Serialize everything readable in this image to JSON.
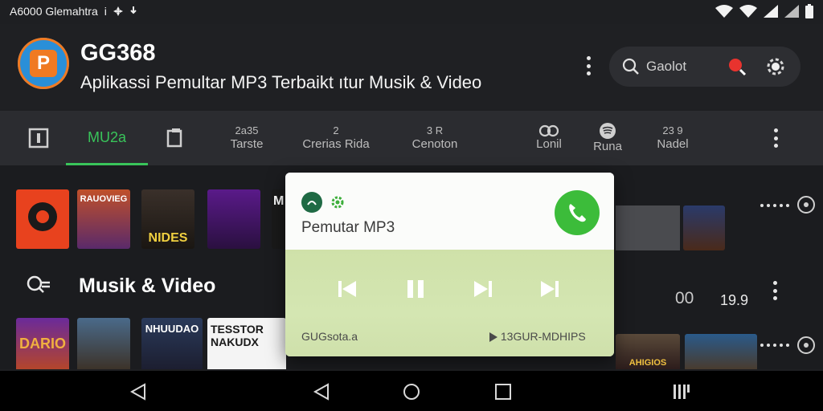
{
  "status_bar": {
    "left_text": "A6000 Glemahtra",
    "left_mark": "i"
  },
  "header": {
    "app_name": "GG368",
    "subtitle": "Aplikassi Pemultar MP3 Terbaikt ıtur Musik & Video",
    "search_placeholder": "Gaolot"
  },
  "tabs": [
    {
      "top": "",
      "label": "",
      "icon": "square-frame-icon"
    },
    {
      "top": "",
      "label": "MU2a",
      "active": true
    },
    {
      "top": "",
      "label": "",
      "icon": "copy-icon"
    },
    {
      "top": "2a35",
      "label": "Tarste"
    },
    {
      "top": "2",
      "label": "Crerias Rida"
    },
    {
      "top": "3 R",
      "label": "Cenoton"
    },
    {
      "top": "",
      "label": "Lonil",
      "icon": "link-icon"
    },
    {
      "top": "",
      "label": "Runa",
      "icon": "spotify-icon"
    },
    {
      "top": "23 9",
      "label": "Nadel"
    }
  ],
  "content": {
    "section_title": "Musik & Video",
    "number_a": "00",
    "number_b": "19.9",
    "row1_thumbs": [
      {
        "title": "",
        "color": "#e8421e"
      },
      {
        "title": "RAUOVIEG",
        "color": "#8a3a6a"
      },
      {
        "title": "NIDES",
        "color": "#2a2420"
      },
      {
        "title": "",
        "color": "#3a2070"
      },
      {
        "title": "M",
        "color": "#222222"
      }
    ],
    "row2_thumbs": [
      {
        "title": "DARIO",
        "color": "#5a2a8a"
      },
      {
        "title": "",
        "color": "#3a5a7a"
      },
      {
        "title": "NHUUDAO",
        "color": "#2a3a5a"
      },
      {
        "title": "TESSTOR NAKUDX",
        "color": "#ffffff"
      }
    ],
    "right_thumbs": [
      {
        "title": "",
        "color": "#3a2a5a"
      },
      {
        "title": "AHIGIOS",
        "color": "#4a3a2a"
      },
      {
        "title": "",
        "color": "#2a4a6a"
      }
    ]
  },
  "player": {
    "title": "Pemutar MP3",
    "footer_left": "GUGsota.a",
    "footer_right": "13GUR-MDHIPS",
    "accent": "#3cbc3a"
  },
  "navbar": {
    "buttons": [
      "back-icon",
      "back-icon",
      "home-icon",
      "recents-icon",
      "menu-icon"
    ]
  }
}
